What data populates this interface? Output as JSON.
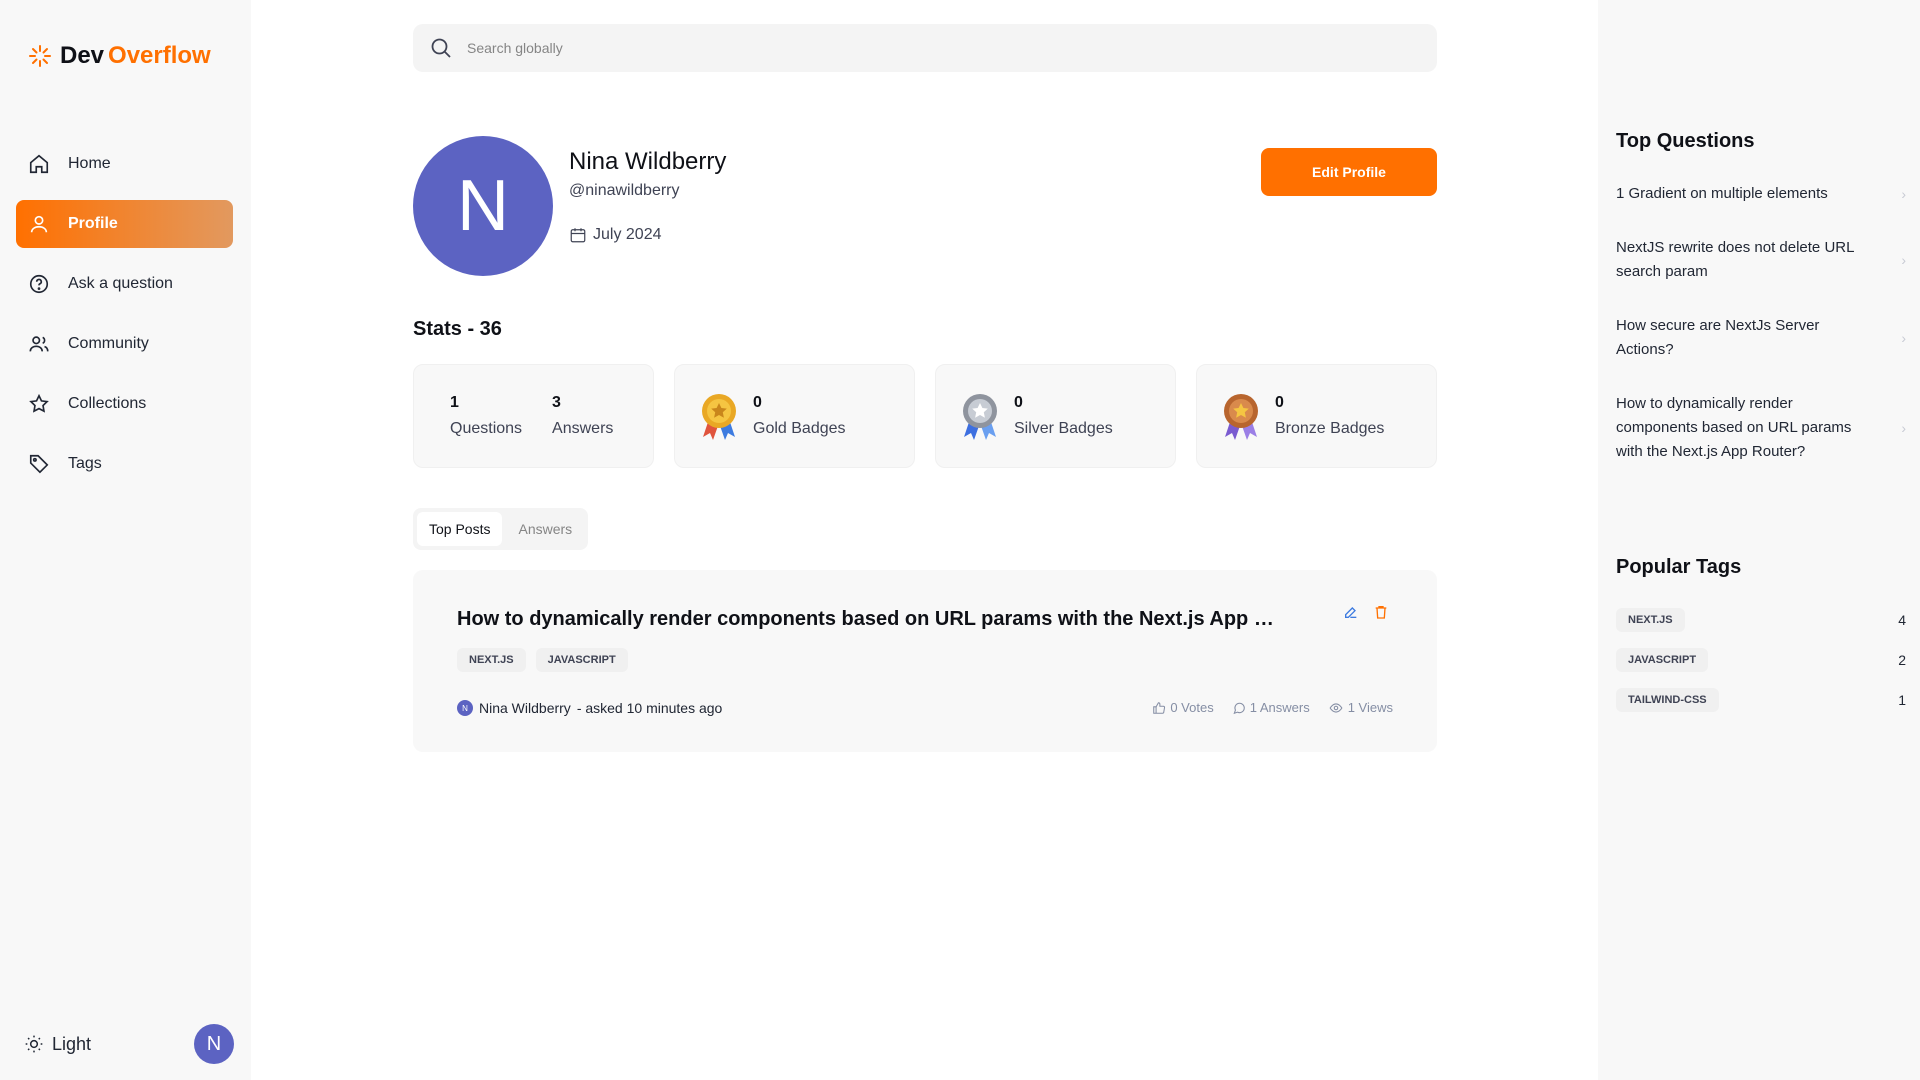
{
  "brand": {
    "name_part1": "Dev",
    "name_part2": "Overflow",
    "accent_color": "#ff7000"
  },
  "sidebar": {
    "items": [
      {
        "label": "Home",
        "icon": "home-icon",
        "active": false
      },
      {
        "label": "Profile",
        "icon": "user-icon",
        "active": true
      },
      {
        "label": "Ask a question",
        "icon": "question-icon",
        "active": false
      },
      {
        "label": "Community",
        "icon": "users-icon",
        "active": false
      },
      {
        "label": "Collections",
        "icon": "star-icon",
        "active": false
      },
      {
        "label": "Tags",
        "icon": "tag-icon",
        "active": false
      }
    ],
    "theme_label": "Light",
    "user_initial": "N"
  },
  "search": {
    "placeholder": "Search globally"
  },
  "profile": {
    "initial": "N",
    "name": "Nina Wildberry",
    "handle": "@ninawildberry",
    "joined": "July 2024",
    "edit_label": "Edit Profile"
  },
  "stats": {
    "title": "Stats - 36",
    "questions_count": "1",
    "questions_label": "Questions",
    "answers_count": "3",
    "answers_label": "Answers",
    "gold_count": "0",
    "gold_label": "Gold Badges",
    "silver_count": "0",
    "silver_label": "Silver Badges",
    "bronze_count": "0",
    "bronze_label": "Bronze Badges"
  },
  "tabs": {
    "top_posts": "Top Posts",
    "answers": "Answers"
  },
  "post": {
    "title": "How to dynamically render components based on URL params with the Next.js App Router?",
    "tags": [
      "NEXT.JS",
      "JAVASCRIPT"
    ],
    "author_initial": "N",
    "author": "Nina Wildberry",
    "asked": "- asked 10 minutes ago",
    "votes": "0 Votes",
    "answers": "1 Answers",
    "views": "1 Views"
  },
  "right": {
    "top_questions_title": "Top Questions",
    "top_questions": [
      "1 Gradient on multiple elements",
      "NextJS rewrite does not delete URL search param",
      "How secure are NextJs Server Actions?",
      "How to dynamically render components based on URL params with the Next.js App Router?"
    ],
    "popular_tags_title": "Popular Tags",
    "popular_tags": [
      {
        "name": "NEXT.JS",
        "count": "4"
      },
      {
        "name": "JAVASCRIPT",
        "count": "2"
      },
      {
        "name": "TAILWIND-CSS",
        "count": "1"
      }
    ]
  }
}
